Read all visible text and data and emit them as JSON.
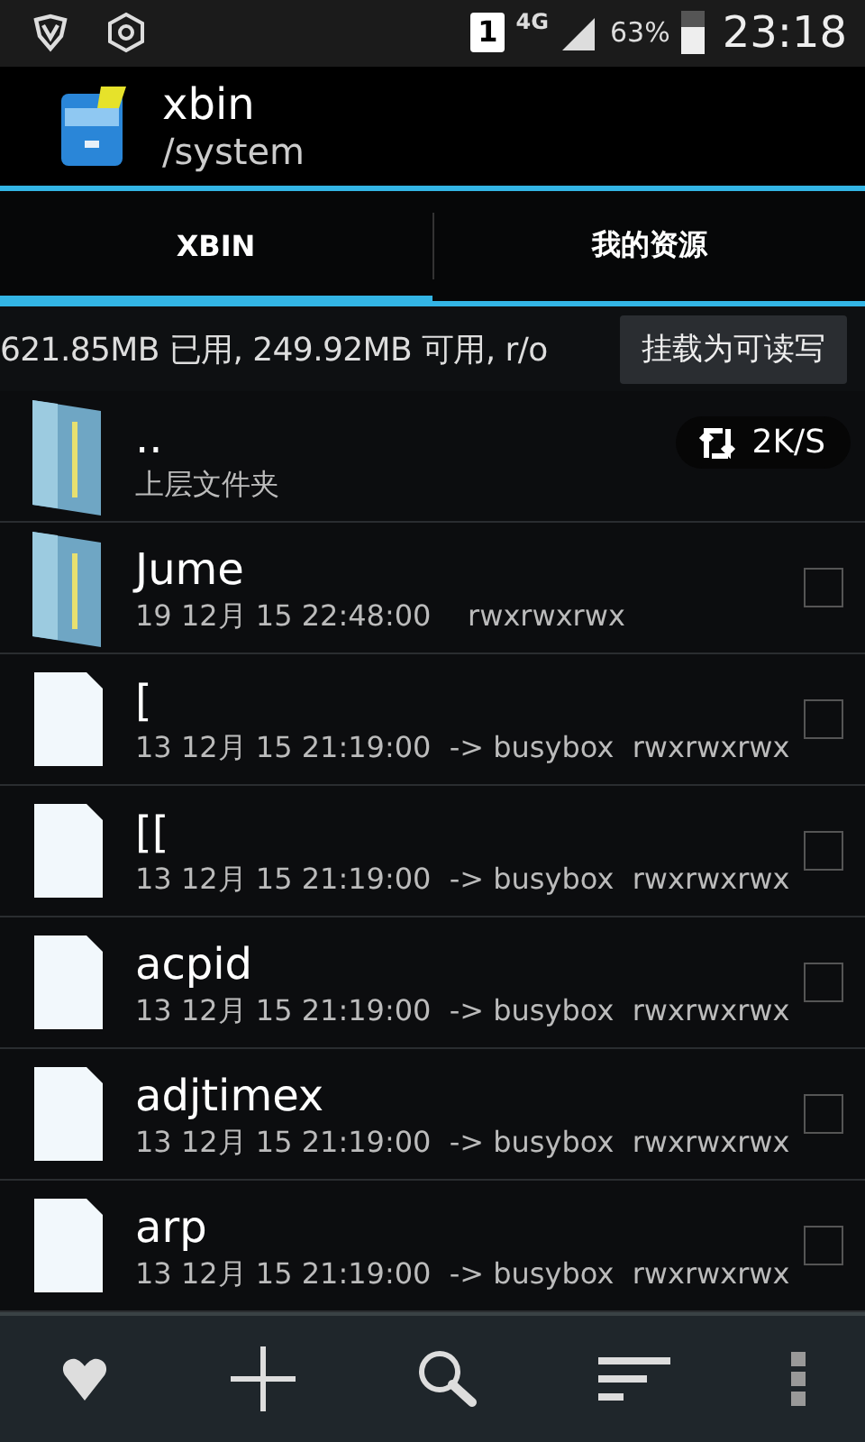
{
  "status_bar": {
    "sim": "1",
    "network": "4G",
    "battery_text": "63%",
    "time": "23:18"
  },
  "header": {
    "title": "xbin",
    "subtitle": "/system"
  },
  "tabs": [
    {
      "label": "XBIN",
      "selected": true
    },
    {
      "label": "我的资源",
      "selected": false
    }
  ],
  "storage": {
    "text": "621.85MB 已用, 249.92MB 可用, r/o",
    "button": "挂载为可读写"
  },
  "speed_badge": "2K/S",
  "rows": [
    {
      "kind": "parent",
      "name": "..",
      "detail": "上层文件夹"
    },
    {
      "kind": "folder",
      "name": "Jume",
      "detail": "19 12月 15 22:48:00    rwxrwxrwx",
      "checked": false
    },
    {
      "kind": "file",
      "name": "[",
      "detail": "13 12月 15 21:19:00  -> busybox  rwxrwxrwx",
      "checked": false
    },
    {
      "kind": "file",
      "name": "[[",
      "detail": "13 12月 15 21:19:00  -> busybox  rwxrwxrwx",
      "checked": false
    },
    {
      "kind": "file",
      "name": "acpid",
      "detail": "13 12月 15 21:19:00  -> busybox  rwxrwxrwx",
      "checked": false
    },
    {
      "kind": "file",
      "name": "adjtimex",
      "detail": "13 12月 15 21:19:00  -> busybox  rwxrwxrwx",
      "checked": false
    },
    {
      "kind": "file",
      "name": "arp",
      "detail": "13 12月 15 21:19:00  -> busybox  rwxrwxrwx",
      "checked": false
    }
  ]
}
